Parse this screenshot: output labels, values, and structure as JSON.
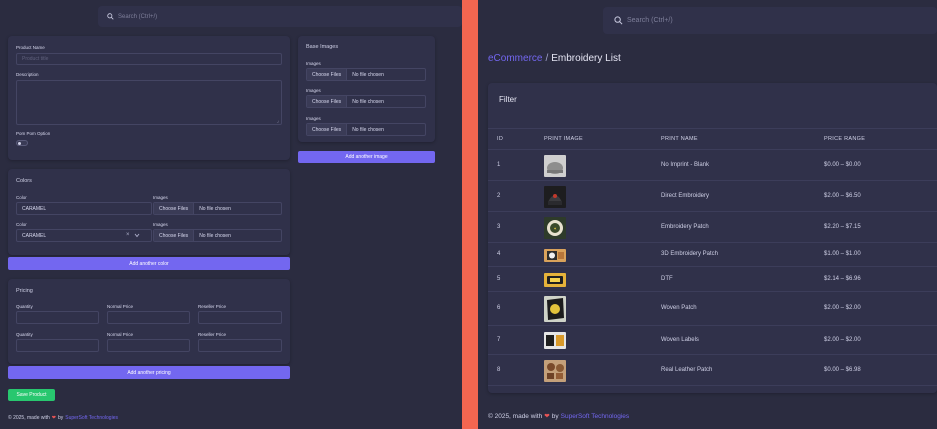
{
  "left": {
    "search_placeholder": "Search (Ctrl+/)",
    "product": {
      "name_label": "Product Name",
      "name_placeholder": "Product title",
      "description_label": "Description",
      "pom_label": "Pom Pom Option"
    },
    "base_images": {
      "title": "Base Images",
      "rows": [
        {
          "label": "Images",
          "button": "Choose Files",
          "file": "No file chosen"
        },
        {
          "label": "Images",
          "button": "Choose Files",
          "file": "No file chosen"
        },
        {
          "label": "Images",
          "button": "Choose Files",
          "file": "No file chosen"
        }
      ],
      "add_button": "Add another image"
    },
    "colors": {
      "title": "Colors",
      "rows": [
        {
          "color_label": "Color",
          "color_value": "CARAMEL",
          "images_label": "Images",
          "button": "Choose Files",
          "file": "No file chosen"
        },
        {
          "color_label": "Color",
          "color_value": "CARAMEL",
          "images_label": "Images",
          "button": "Choose Files",
          "file": "No file chosen"
        }
      ],
      "add_button": "Add another color"
    },
    "pricing": {
      "title": "Pricing",
      "rows": [
        {
          "qty": "Quantity",
          "normal": "Normal Price",
          "reseller": "Reseller Price"
        },
        {
          "qty": "Quantity",
          "normal": "Normal Price",
          "reseller": "Reseller Price"
        }
      ],
      "add_button": "Add another pricing"
    },
    "save_button": "Save Product",
    "footer": {
      "prefix": "© 2025, made with",
      "by": "by",
      "brand": "SuperSoft Technologies"
    }
  },
  "right": {
    "search_placeholder": "Search (Ctrl+/)",
    "breadcrumb": {
      "parent": "eCommerce",
      "separator": "/",
      "current": "Embroidery List"
    },
    "filter_title": "Filter",
    "columns": [
      "ID",
      "PRINT IMAGE",
      "PRINT NAME",
      "PRICE RANGE"
    ],
    "rows": [
      {
        "id": "1",
        "name": "No Imprint - Blank",
        "price": "$0.00 – $0.00",
        "thumb": "cap"
      },
      {
        "id": "2",
        "name": "Direct Embroidery",
        "price": "$2.00 – $6.50",
        "thumb": "beanie"
      },
      {
        "id": "3",
        "name": "Embroidery Patch",
        "price": "$2.20 – $7.15",
        "thumb": "patch"
      },
      {
        "id": "4",
        "name": "3D Embroidery Patch",
        "price": "$1.00 – $1.00",
        "thumb": "3d"
      },
      {
        "id": "5",
        "name": "DTF",
        "price": "$2.14 – $6.96",
        "thumb": "dtf"
      },
      {
        "id": "6",
        "name": "Woven Patch",
        "price": "$2.00 – $2.00",
        "thumb": "woven"
      },
      {
        "id": "7",
        "name": "Woven Labels",
        "price": "$2.00 – $2.00",
        "thumb": "labels"
      },
      {
        "id": "8",
        "name": "Real Leather Patch",
        "price": "$0.00 – $6.98",
        "thumb": "leather"
      }
    ],
    "footer": {
      "prefix": "© 2025, made with",
      "by": "by",
      "brand": "SuperSoft Technologies"
    }
  },
  "colors": {
    "accent": "#7367f0",
    "divider": "#f26650",
    "success": "#28c76f",
    "heart": "#ea5455"
  }
}
